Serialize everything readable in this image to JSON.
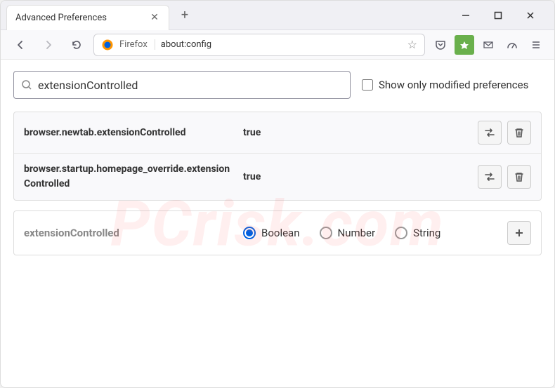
{
  "window": {
    "tab_title": "Advanced Preferences"
  },
  "urlbar": {
    "brand": "Firefox",
    "url": "about:config"
  },
  "search": {
    "value": "extensionControlled",
    "modified_label": "Show only modified preferences"
  },
  "prefs": [
    {
      "name": "browser.newtab.extensionControlled",
      "value": "true"
    },
    {
      "name": "browser.startup.homepage_override.extensionControlled",
      "value": "true"
    }
  ],
  "new_pref": {
    "name": "extensionControlled",
    "types": [
      "Boolean",
      "Number",
      "String"
    ],
    "selected": "Boolean"
  },
  "watermark": "PCrisk.com"
}
